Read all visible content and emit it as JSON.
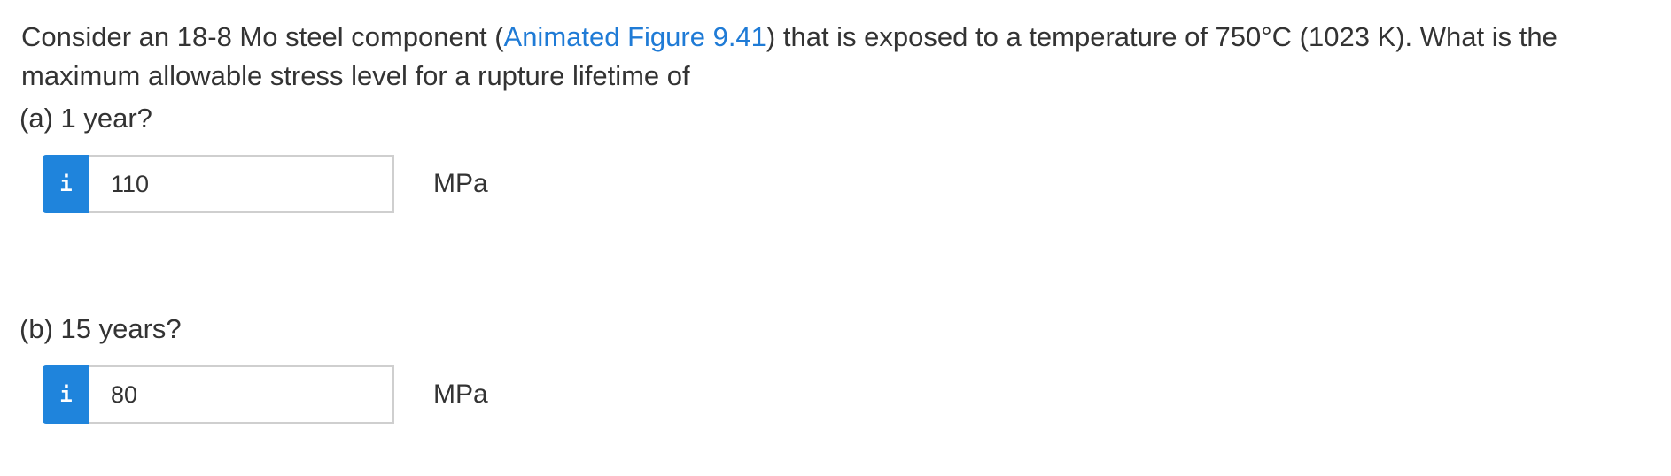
{
  "question": {
    "text_before_link": "Consider an 18-8 Mo steel component (",
    "link_text": "Animated Figure 9.41",
    "text_after_link": ") that is exposed to a temperature of 750°C (1023 K). What is the maximum allowable stress level for a rupture lifetime of"
  },
  "parts": [
    {
      "label": "(a) 1 year?",
      "info_icon": "i",
      "answer_value": "110",
      "unit": "MPa"
    },
    {
      "label": "(b) 15 years?",
      "info_icon": "i",
      "answer_value": "80",
      "unit": "MPa"
    }
  ],
  "colors": {
    "link": "#1f7bd6",
    "info_button": "#1f84dc",
    "text": "#333333",
    "input_border": "#cfcfcf"
  }
}
